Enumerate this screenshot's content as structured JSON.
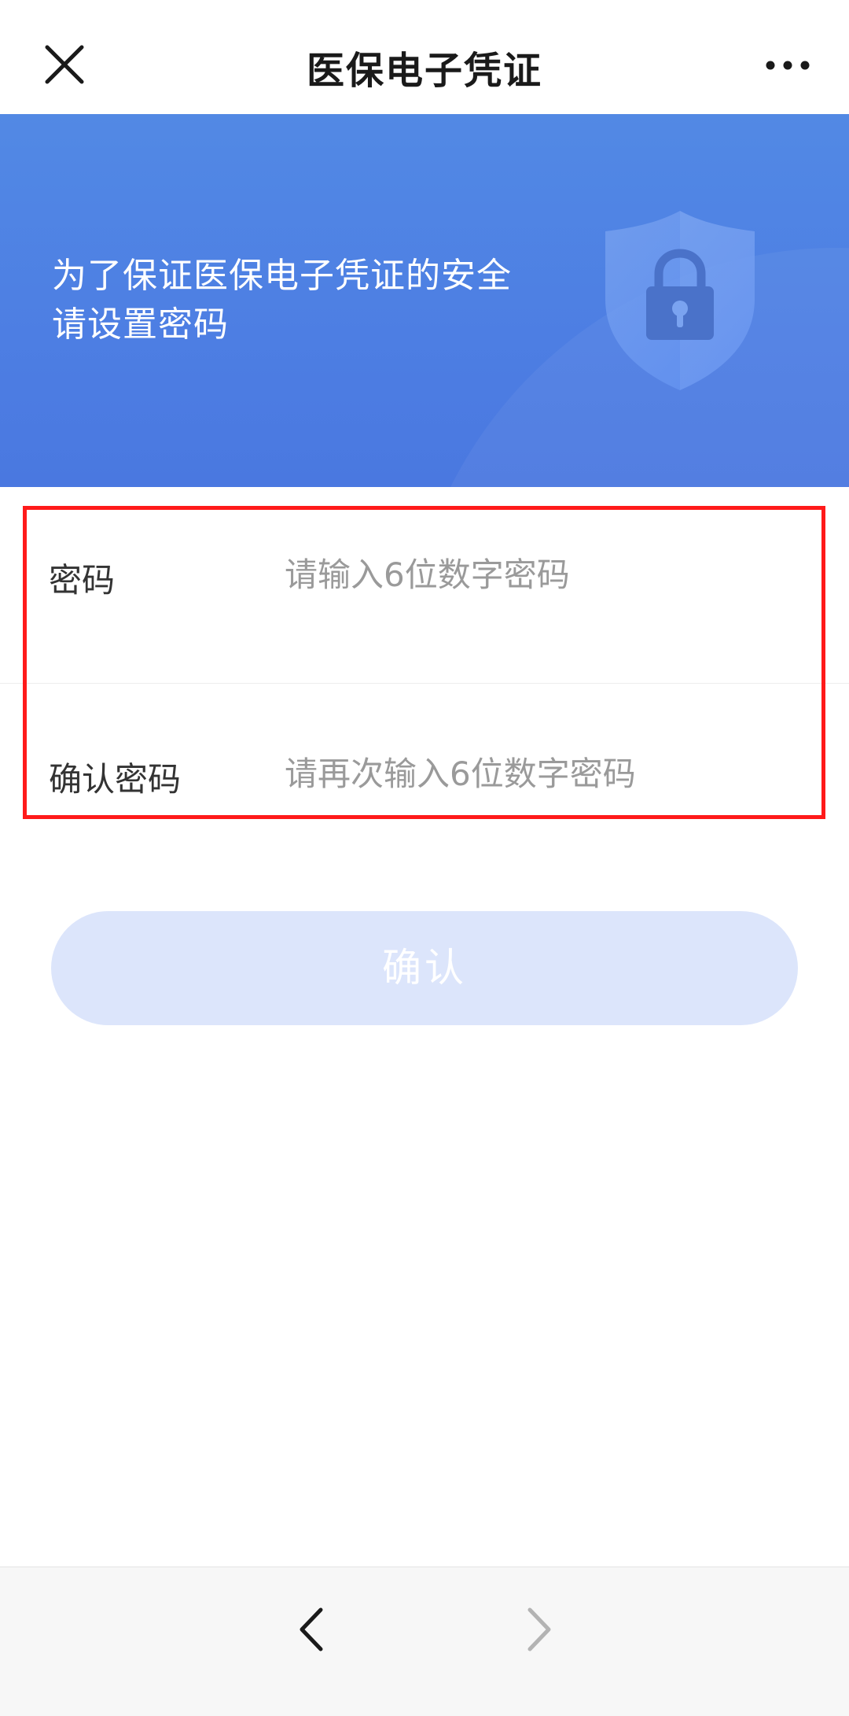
{
  "navbar": {
    "title": "医保电子凭证",
    "close_icon": "close-icon",
    "more_icon": "more-icon"
  },
  "banner": {
    "line1": "为了保证医保电子凭证的安全",
    "line2": "请设置密码",
    "icon": "shield-lock-icon",
    "color_primary": "#4d7ee3"
  },
  "form": {
    "password": {
      "label": "密码",
      "placeholder": "请输入6位数字密码",
      "value": ""
    },
    "confirm_password": {
      "label": "确认密码",
      "placeholder": "请再次输入6位数字密码",
      "value": ""
    }
  },
  "confirm_button": {
    "label": "确认",
    "color": "#dce5fb"
  },
  "bottom_bar": {
    "back_icon": "chevron-left-icon",
    "forward_icon": "chevron-right-icon"
  },
  "highlight": {
    "color": "#ff1a1a"
  }
}
